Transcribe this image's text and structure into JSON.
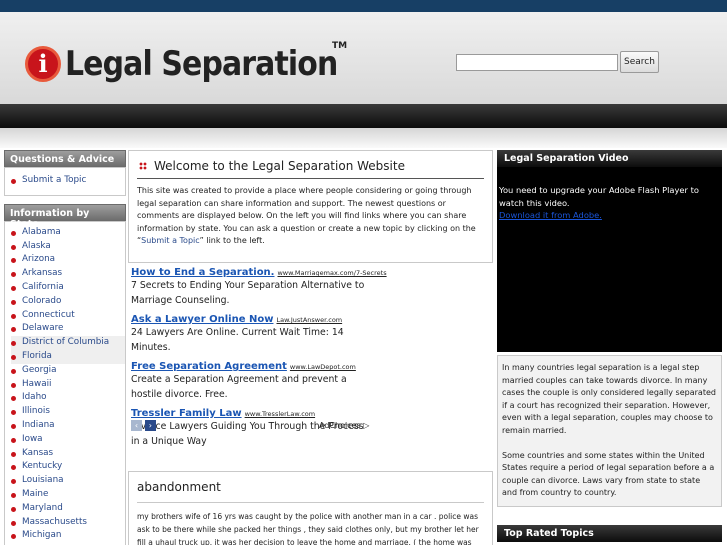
{
  "header": {
    "logo_text": "Legal Separation",
    "logo_tm": "TM",
    "logo_icon": "i",
    "search_placeholder": "",
    "search_button": "Search"
  },
  "sidebar": {
    "qa_title": "Questions & Advice",
    "qa_items": [
      "Submit a Topic"
    ],
    "state_title": "Information by State",
    "states": [
      "Alabama",
      "Alaska",
      "Arizona",
      "Arkansas",
      "California",
      "Colorado",
      "Connecticut",
      "Delaware",
      "District of Columbia",
      "Florida",
      "Georgia",
      "Hawaii",
      "Idaho",
      "Illinois",
      "Indiana",
      "Iowa",
      "Kansas",
      "Kentucky",
      "Louisiana",
      "Maine",
      "Maryland",
      "Massachusetts",
      "Michigan"
    ]
  },
  "welcome": {
    "title": "Welcome to the Legal Separation Website",
    "body_before": "This site was created to provide a place where people considering or going through legal separation can share information and support. The newest questions or comments are displayed below. On the left you will find links where you can share information by state. You can ask a question or create a new topic by clicking on the “",
    "body_link": "Submit a Topic",
    "body_after": "” link to the left."
  },
  "ads": [
    {
      "title": "How to End a Separation.",
      "url": "www.Marriagemax.com/7-Secrets",
      "desc": "7 Secrets to Ending Your Separation Alternative to Marriage Counseling."
    },
    {
      "title": "Ask a Lawyer Online Now",
      "url": "Law.JustAnswer.com",
      "desc": "24 Lawyers Are Online. Current Wait Time: 14 Minutes."
    },
    {
      "title": "Free Separation Agreement",
      "url": "www.LawDepot.com",
      "desc": "Create a Separation Agreement and prevent a hostile divorce. Free."
    },
    {
      "title": "Tressler Family Law",
      "url": "www.TresslerLaw.com",
      "desc": "Divorce Lawyers Guiding You Through the Process in a Unique Way"
    }
  ],
  "ad_choices": "AdChoices",
  "topic": {
    "title": "abandonment",
    "body": "my brothers wife of 16 yrs was caught by the police with another man in a car . police was ask to be there while she packed her things , they said clothes only, but my brother let her fill a uhaul truck up. it was her decision to leave the home and marriage. ( the home was"
  },
  "right": {
    "video_title": "Legal Separation Video",
    "video_msg": "You need to upgrade your Adobe Flash Player to watch this video.",
    "video_link": "Download it from Adobe.",
    "about_p1": "In many countries legal separation is a legal step married couples can take towards divorce. In many cases the couple is only considered legally separated if a court has recognized their separation. However, even with a legal separation, couples may choose to remain married.",
    "about_p2": "Some countries and some states within the United States require a period of legal separation before a a couple can divorce. Laws vary from state to state and from country to country.",
    "top_rated_title": "Top Rated Topics"
  }
}
